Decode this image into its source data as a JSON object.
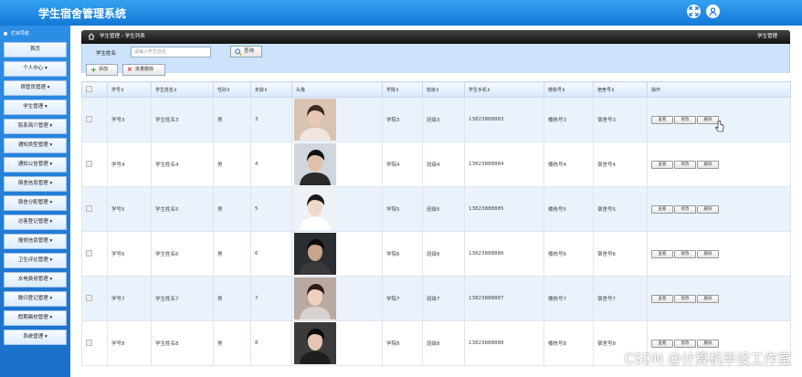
{
  "app": {
    "title": "学生宿舍管理系统"
  },
  "topbar": {
    "icons": [
      "fullscreen-icon",
      "user-icon"
    ]
  },
  "sidebar": {
    "header": "栏目导航",
    "items": [
      "首页",
      "个人中心 ▾",
      "宿管员管理 ▾",
      "学生管理 ▾",
      "院系简介管理 ▾",
      "通知类型管理 ▾",
      "通知公告管理 ▾",
      "宿舍信息管理 ▾",
      "宿舍分配管理 ▾",
      "访客登记管理 ▾",
      "报修信息管理 ▾",
      "卫生评比管理 ▾",
      "水电费用管理 ▾",
      "晚归登记管理 ▾",
      "假期离校管理 ▾",
      "系统管理 ▾"
    ]
  },
  "breadcrumb": {
    "text": "学生管理 › 学生列表",
    "right": "学生管理"
  },
  "filter": {
    "label": "学生姓名",
    "placeholder": "请输入学生姓名",
    "search": "查询"
  },
  "toolbar": {
    "add": "添加",
    "batch_delete": "批量删除"
  },
  "table": {
    "headers": [
      "",
      "学号⇕",
      "学生姓名⇕",
      "性别⇕",
      "年龄⇕",
      "头像",
      "学院⇕",
      "班级⇕",
      "学生手机⇕",
      "楼栋号⇕",
      "宿舍号⇕",
      "操作"
    ],
    "rows": [
      {
        "id": "学号3",
        "name": "学生姓名3",
        "sex": "男",
        "age": "3",
        "college": "学院3",
        "cls": "班级3",
        "phone": "13823888883",
        "bld": "楼栋号3",
        "room": "宿舍号3"
      },
      {
        "id": "学号4",
        "name": "学生姓名4",
        "sex": "男",
        "age": "4",
        "college": "学院4",
        "cls": "班级4",
        "phone": "13823888884",
        "bld": "楼栋号4",
        "room": "宿舍号4"
      },
      {
        "id": "学号5",
        "name": "学生姓名5",
        "sex": "男",
        "age": "5",
        "college": "学院5",
        "cls": "班级5",
        "phone": "13823888885",
        "bld": "楼栋号5",
        "room": "宿舍号5"
      },
      {
        "id": "学号6",
        "name": "学生姓名6",
        "sex": "男",
        "age": "6",
        "college": "学院6",
        "cls": "班级6",
        "phone": "13823888886",
        "bld": "楼栋号6",
        "room": "宿舍号6"
      },
      {
        "id": "学号7",
        "name": "学生姓名7",
        "sex": "男",
        "age": "7",
        "college": "学院7",
        "cls": "班级7",
        "phone": "13823888887",
        "bld": "楼栋号7",
        "room": "宿舍号7"
      },
      {
        "id": "学号8",
        "name": "学生姓名8",
        "sex": "男",
        "age": "8",
        "college": "学院8",
        "cls": "班级8",
        "phone": "13823888888",
        "bld": "楼栋号8",
        "room": "宿舍号8"
      }
    ],
    "ops": [
      "查看",
      "修改",
      "删除"
    ]
  },
  "watermark": "CSDN @计算机毕设工作室",
  "colors": {
    "header_blue": "#1477d6",
    "row_alt": "#eaf2fc"
  }
}
